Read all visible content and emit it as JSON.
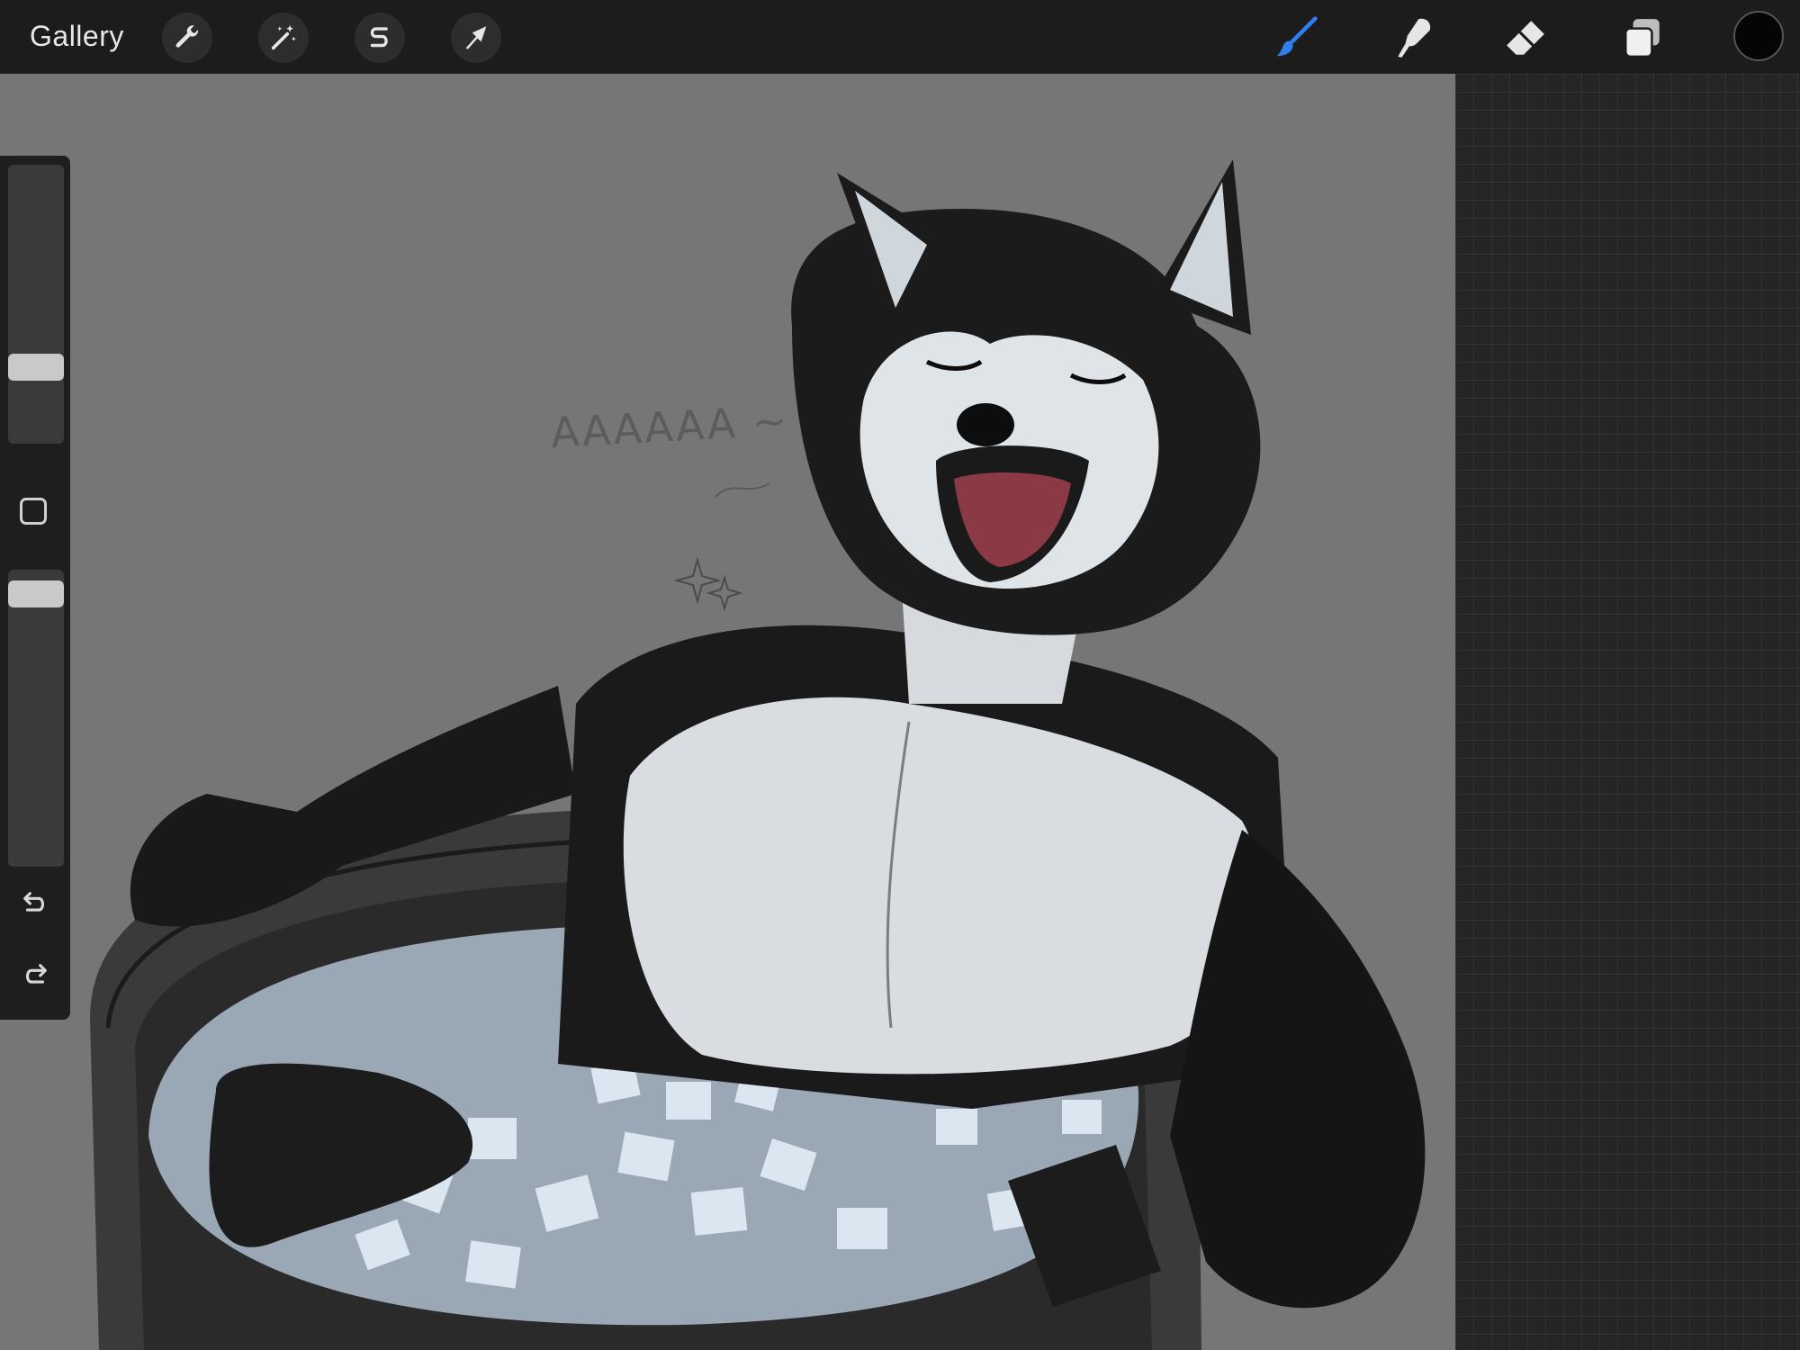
{
  "topbar": {
    "gallery_label": "Gallery",
    "left_tools": [
      {
        "name": "actions",
        "icon": "wrench-icon"
      },
      {
        "name": "adjustments",
        "icon": "magic-wand-icon"
      },
      {
        "name": "selection",
        "icon": "selection-s-icon"
      },
      {
        "name": "transform",
        "icon": "arrow-cursor-icon"
      }
    ],
    "right_tools": [
      {
        "name": "brush",
        "icon": "brush-icon",
        "active": true
      },
      {
        "name": "smudge",
        "icon": "smudge-finger-icon"
      },
      {
        "name": "eraser",
        "icon": "eraser-icon"
      },
      {
        "name": "layers",
        "icon": "layers-icon"
      }
    ],
    "current_color": "#050505",
    "accent_color": "#2f7ff0"
  },
  "sidebar": {
    "brush_size_level": 0.25,
    "opacity_level": 0.96,
    "icons": [
      "modify-square-icon",
      "undo-icon",
      "redo-icon"
    ]
  },
  "canvas": {
    "sketch_text": "AAAAAA ~",
    "background_color": "#767676"
  }
}
